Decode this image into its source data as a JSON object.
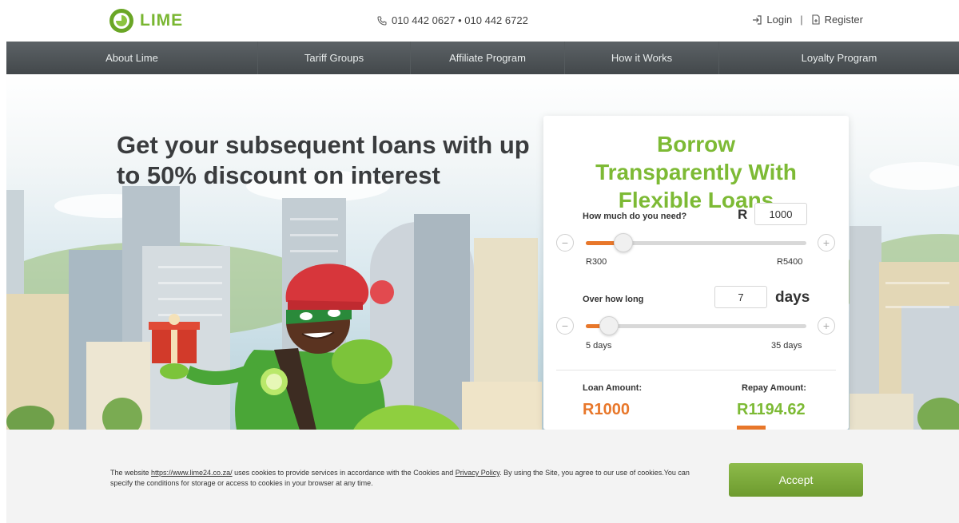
{
  "header": {
    "logo_text": "LIME",
    "phones": "010 442 0627  •  010 442 6722",
    "login": "Login",
    "separator": "|",
    "register": "Register"
  },
  "nav": {
    "items": [
      "About Lime",
      "Tariff Groups",
      "Affiliate Program",
      "How it Works",
      "Loyalty Program"
    ]
  },
  "hero": {
    "title": "Get your subsequent loans with up to 50% discount on interest"
  },
  "calculator": {
    "title": "Borrow Transparently With Flexible Loans",
    "amount_label": "How much do you need?",
    "currency": "R",
    "amount_value": "1000",
    "amount_min": "R300",
    "amount_max": "R5400",
    "amount_slider_value": 1000,
    "amount_slider_min": 300,
    "amount_slider_max": 5400,
    "term_label": "Over how long",
    "term_value": "7",
    "term_unit": "days",
    "term_min": "5 days",
    "term_max": "35 days",
    "term_slider_value": 7,
    "term_slider_min": 5,
    "term_slider_max": 35,
    "minus": "−",
    "plus": "+",
    "loan_amount_label": "Loan Amount:",
    "loan_amount_value": "R1000",
    "repay_amount_label": "Repay Amount:",
    "repay_amount_value": "R1194.62"
  },
  "cookie": {
    "text_before": "The website ",
    "site_link": "https://www.lime24.co.za/",
    "text_middle": " uses cookies to provide services in accordance with the Cookies and ",
    "privacy_link": "Privacy Policy",
    "text_after": ". By using the Site, you agree to our use of cookies.You can specify the conditions for storage or access to cookies in your browser at any time.",
    "accept": "Accept"
  },
  "colors": {
    "brand_green": "#7dba35",
    "accent_orange": "#e8772a",
    "nav_bg": "#4d5255"
  }
}
